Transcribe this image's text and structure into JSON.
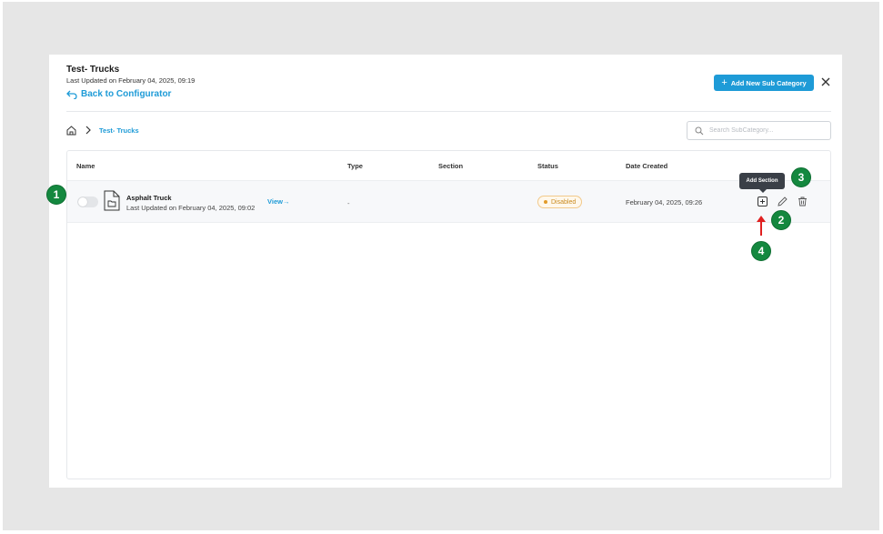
{
  "modal": {
    "title": "Test- Trucks",
    "subtitle": "Last Updated on February 04, 2025, 09:19",
    "back_label": "Back to Configurator",
    "add_button_label": "Add New Sub Category"
  },
  "breadcrumb": {
    "current": "Test- Trucks"
  },
  "search": {
    "placeholder": "Search SubCategory..."
  },
  "table": {
    "columns": [
      "Name",
      "Type",
      "Section",
      "Status",
      "Date Created"
    ],
    "rows": [
      {
        "name": "Asphalt Truck",
        "updated": "Last Updated on February 04, 2025, 09:02",
        "view_label": "View",
        "type": "-",
        "section": "",
        "status": "Disabled",
        "date_created": "February 04, 2025, 09:26"
      }
    ]
  },
  "tooltip": {
    "label": "Add Section"
  },
  "callouts": [
    "1",
    "2",
    "3",
    "4"
  ],
  "colors": {
    "accent": "#1e9bd7",
    "callout": "#14883f",
    "status_disabled": "#e29b29",
    "arrow": "#e02020"
  }
}
